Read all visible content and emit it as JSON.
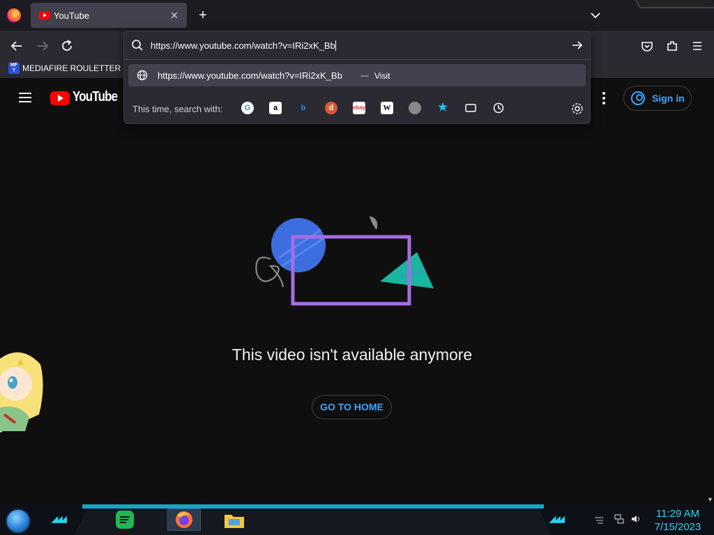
{
  "browser": {
    "tab": {
      "title": "YouTube"
    },
    "new_tab_glyph": "+",
    "close_glyph": "✕",
    "url_panel": {
      "typed_url": "https://www.youtube.com/watch?v=IRi2xK_Bb",
      "suggestion_url": "https://www.youtube.com/watch?v=IRi2xK_Bb",
      "suggestion_dash": "—",
      "suggestion_action": "Visit",
      "search_with_label": "This time, search with:",
      "engines": [
        "google",
        "amazon",
        "bing",
        "duckduckgo",
        "ebay",
        "wikipedia",
        "search-add",
        "bookmarks",
        "tabs",
        "history"
      ]
    },
    "bookmarks": [
      {
        "label": "MEDIAFIRE ROULETTER",
        "icon_text": "MF T"
      }
    ]
  },
  "youtube": {
    "logo_text": "YouTube",
    "signin_label": "Sign in",
    "error_message": "This video isn't available anymore",
    "go_home_label": "GO TO HOME"
  },
  "taskbar": {
    "time": "11:29 AM",
    "date": "7/15/2023",
    "apps": [
      "spotify",
      "firefox",
      "file-explorer"
    ]
  },
  "colors": {
    "youtube_bg": "#0f0f0f",
    "link_blue": "#3ea6ff",
    "taskbar_accent": "#27d3f5",
    "firefox_toolbar": "#2b2a33"
  }
}
